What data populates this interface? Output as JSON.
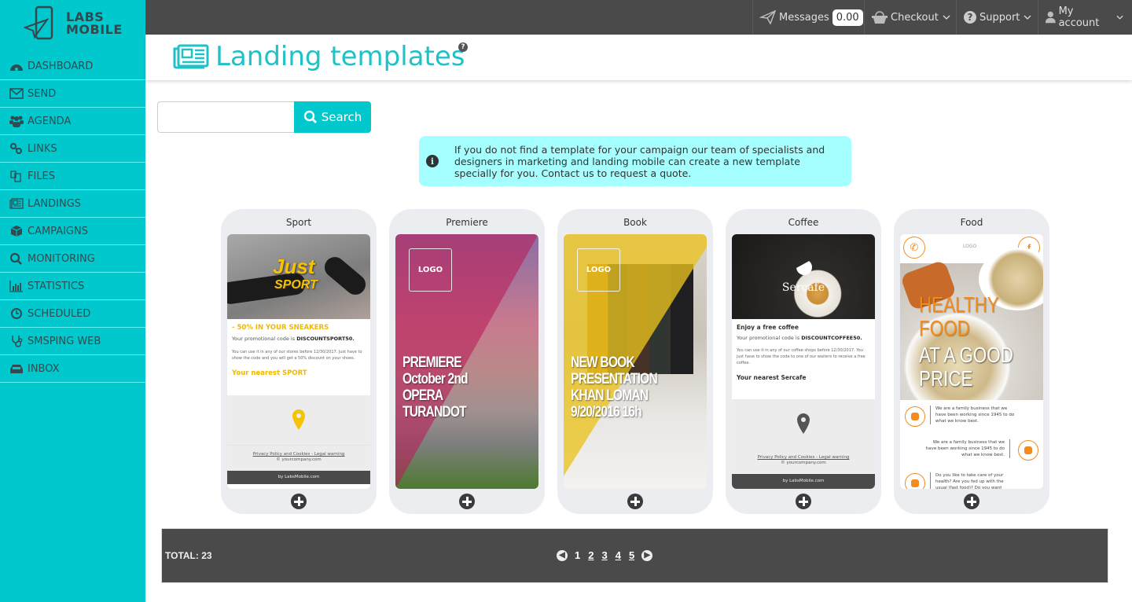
{
  "brand": {
    "line1": "LABS",
    "line2": "MOBILE"
  },
  "sidebar": {
    "items": [
      {
        "label": "DASHBOARD",
        "icon": "dashboard-icon"
      },
      {
        "label": "SEND",
        "icon": "envelope-icon"
      },
      {
        "label": "AGENDA",
        "icon": "users-icon"
      },
      {
        "label": "LINKS",
        "icon": "link-icon"
      },
      {
        "label": "FILES",
        "icon": "files-icon"
      },
      {
        "label": "LANDINGS",
        "icon": "newspaper-icon"
      },
      {
        "label": "CAMPAIGNS",
        "icon": "cube-icon"
      },
      {
        "label": "MONITORING",
        "icon": "search-icon"
      },
      {
        "label": "STATISTICS",
        "icon": "bar-chart-icon"
      },
      {
        "label": "SCHEDULED",
        "icon": "clock-icon"
      },
      {
        "label": "SMSPING WEB",
        "icon": "stethoscope-icon"
      },
      {
        "label": "INBOX",
        "icon": "inbox-icon"
      }
    ]
  },
  "topbar": {
    "messages_label": "Messages",
    "messages_balance": "0.00",
    "checkout_label": "Checkout",
    "support_label": "Support",
    "account_label": "My account"
  },
  "page": {
    "title": "Landing templates",
    "help_icon": "?"
  },
  "search": {
    "value": "",
    "placeholder": "",
    "button_label": "Search"
  },
  "info": {
    "text": "If you do not find a template for your campaign our team of specialists and designers in marketing and landing mobile can create a new template specially for you. Contact us to request a quote."
  },
  "templates": [
    {
      "name": "Sport",
      "accent": "#f0b800",
      "hero_line1": "Just",
      "hero_line2": "SPORT",
      "heading": "- 50% IN YOUR SNEAKERS",
      "promo_prefix": "Your promotional code is",
      "promo_code": "DISCOUNTSPORT50.",
      "body": "You can use it in any of our stores before 12/30/2017. Just have to show the code and you will get a 50% discount on your shoes.",
      "nearest": "Your nearest SPORT",
      "legal": "Privacy Policy and Cookies - Legal warning",
      "copyright": "© yourcompany.com",
      "by": "by LabsMobile.com"
    },
    {
      "name": "Premiere",
      "accent": "#c0245f",
      "logo": "LOGO",
      "lines": [
        "PREMIERE",
        "October 2nd",
        "OPERA",
        "TURANDOT"
      ]
    },
    {
      "name": "Book",
      "accent": "#e6c02a",
      "logo": "LOGO",
      "lines": [
        "NEW BOOK",
        "PRESENTATION",
        "KHAN LOMAN",
        "9/20/2016 16h"
      ]
    },
    {
      "name": "Coffee",
      "brand": "Sercafe",
      "heading": "Enjoy a free coffee",
      "promo_prefix": "Your promotional code is",
      "promo_code": "DISCOUNTCOFFEE50.",
      "body": "You can use it in any of our coffee shops before 12/30/2017. You just have to show the code to one of our waiters to receive a free coffee.",
      "nearest": "Your nearest Sercafe",
      "legal": "Privacy Policy and Cookies - Legal warning",
      "copyright": "© yourcompany.com",
      "by": "by LabsMobile.com"
    },
    {
      "name": "Food",
      "accent": "#f28c1c",
      "logo": "LOGO",
      "hero_line1": "HEALTHY",
      "hero_line2": "FOOD",
      "hero_line3": "AT A GOOD",
      "hero_line4": "PRICE",
      "row1": "We are a family business that we have been working since 1945 to do what we know best.",
      "row2": "We are a family business that we have been working since 1945 to do what we know best.",
      "row3": "Do you like to take care of your health? Are you fed up with the usual (fast food)? Do you want something"
    }
  ],
  "footer": {
    "total": "TOTAL: 23",
    "pages": [
      "1",
      "2",
      "3",
      "4",
      "5"
    ],
    "current_page": "1"
  }
}
